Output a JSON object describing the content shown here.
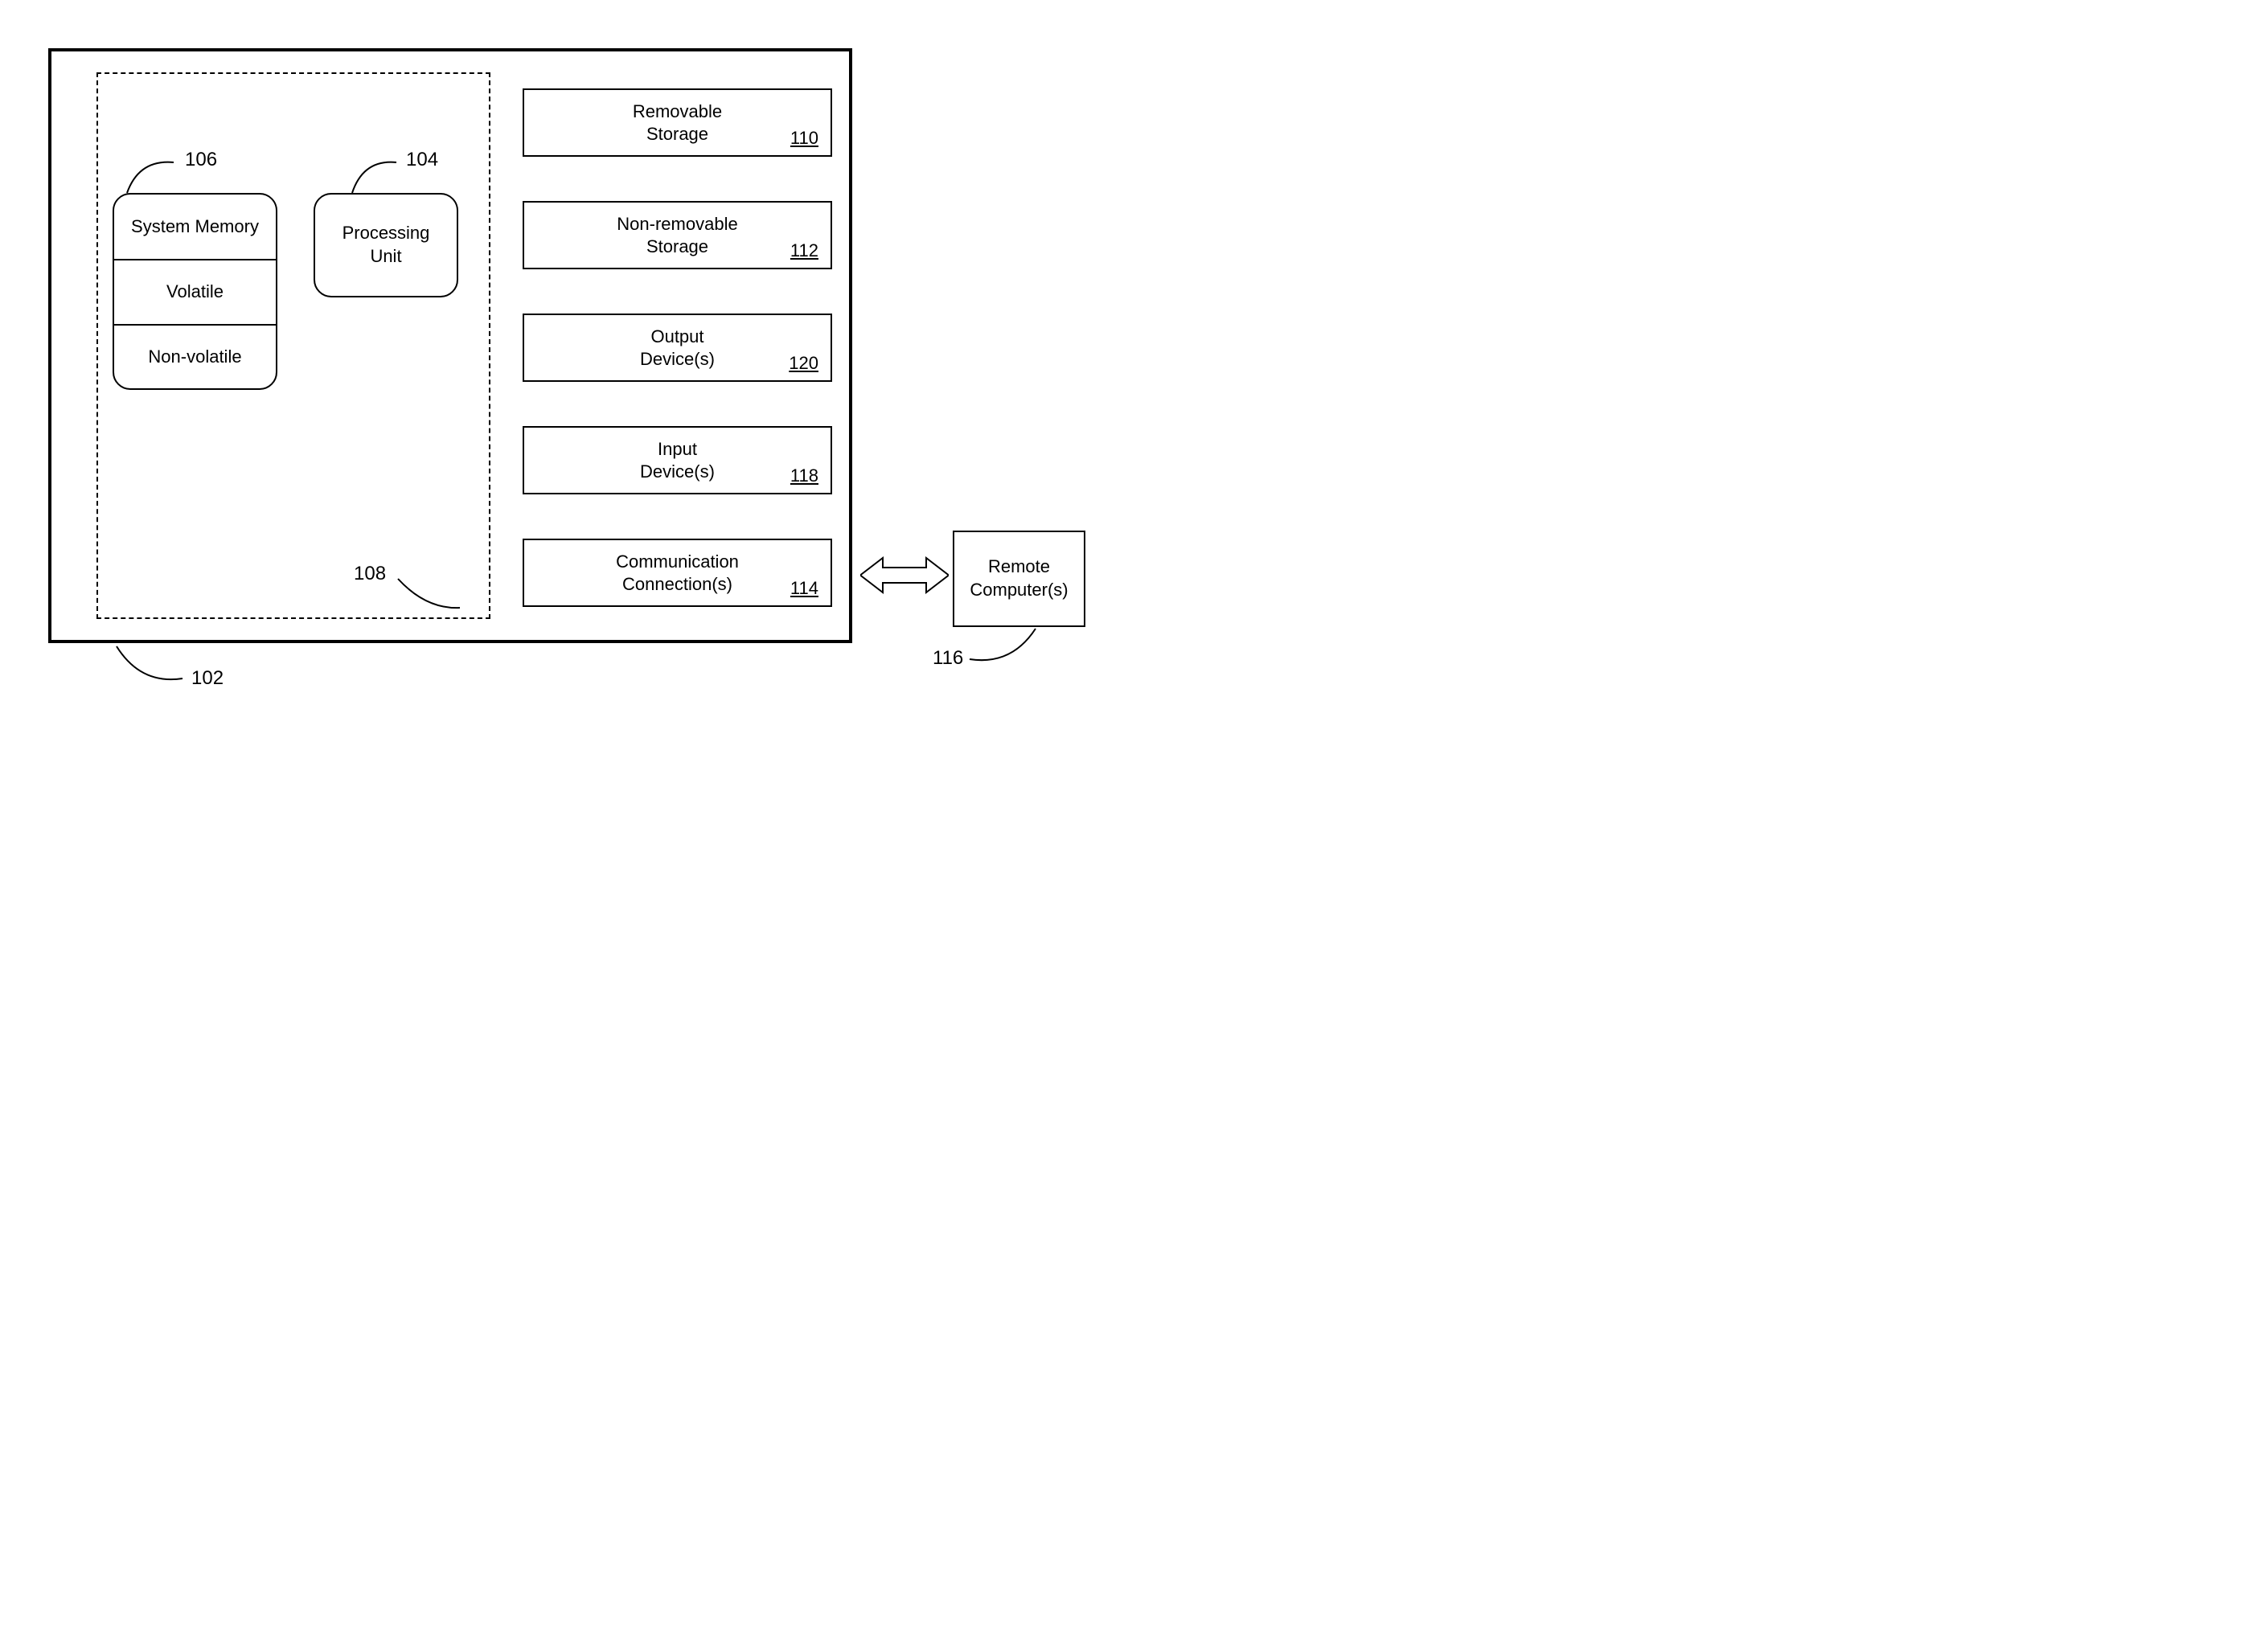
{
  "labels": {
    "ref102": "102",
    "ref104": "104",
    "ref106": "106",
    "ref108": "108",
    "ref110": "110",
    "ref112": "112",
    "ref114": "114",
    "ref116": "116",
    "ref118": "118",
    "ref120": "120"
  },
  "memory": {
    "title": "System Memory",
    "volatile": "Volatile",
    "nonvolatile": "Non-volatile"
  },
  "processing": "Processing\nUnit",
  "right": {
    "removable": "Removable\nStorage",
    "nonremovable": "Non-removable\nStorage",
    "output": "Output\nDevice(s)",
    "input": "Input\nDevice(s)",
    "comm": "Communication\nConnection(s)"
  },
  "remote": "Remote\nComputer(s)"
}
